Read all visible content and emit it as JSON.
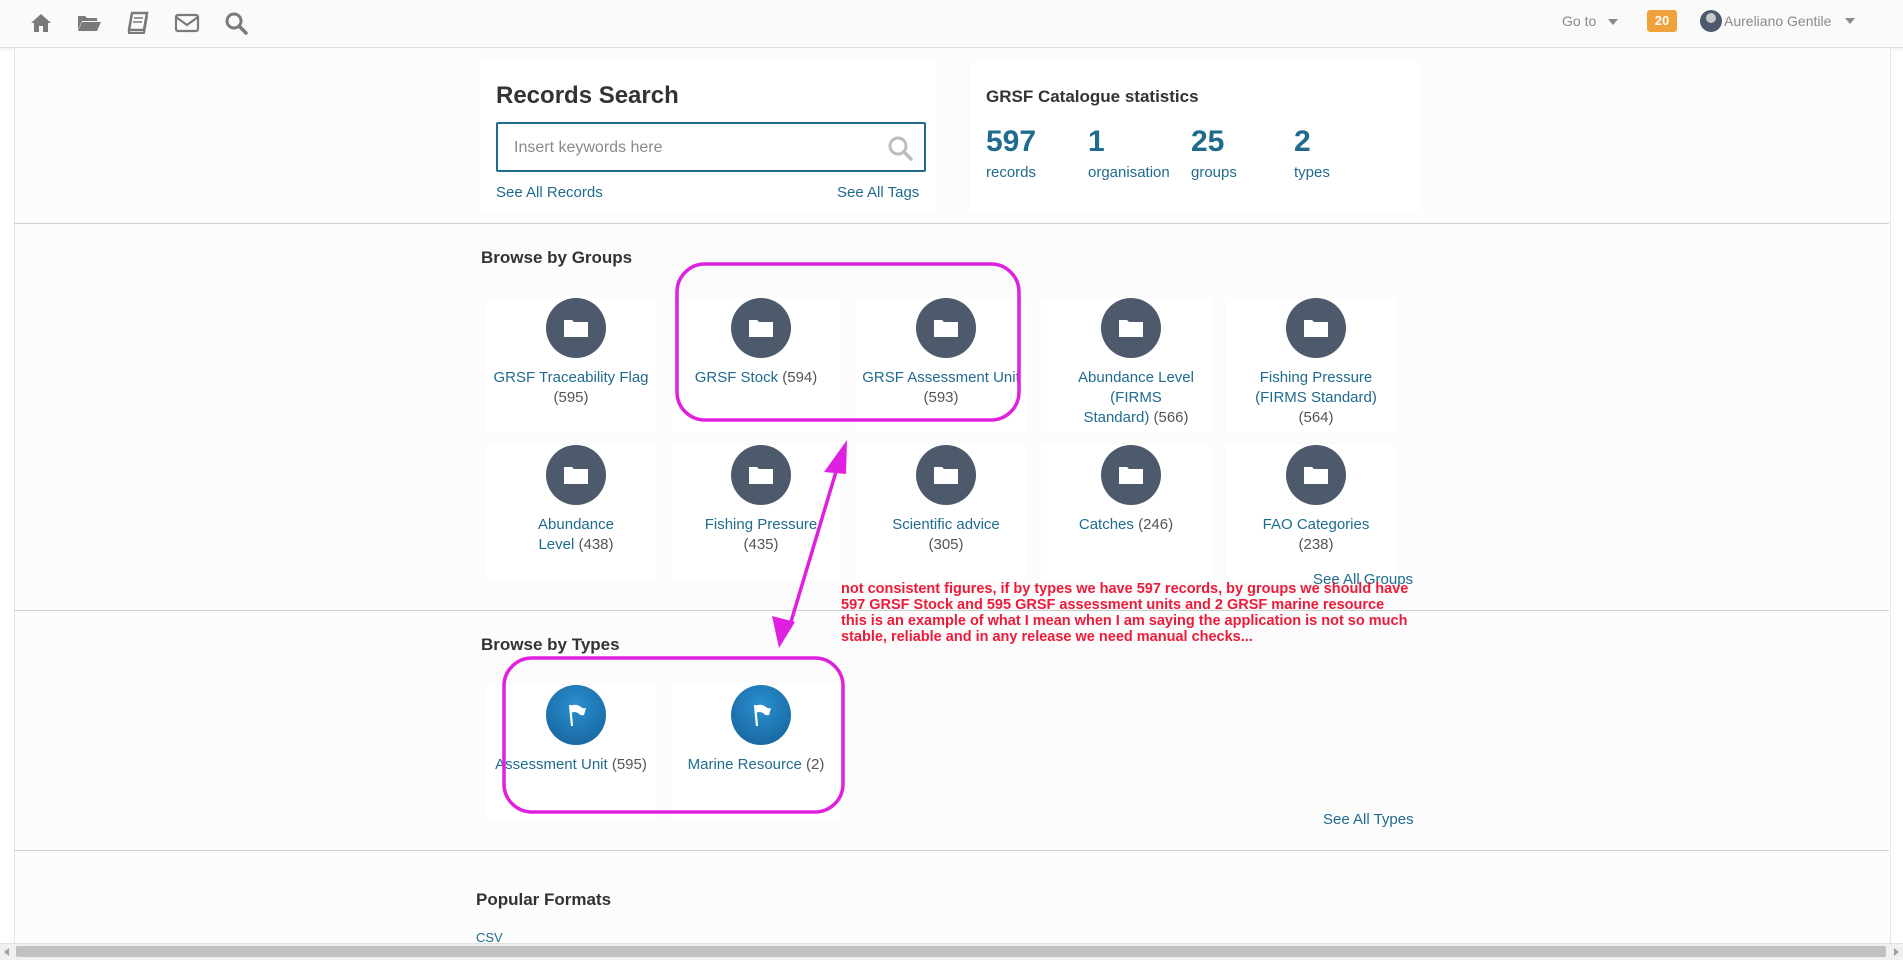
{
  "topbar": {
    "icons": [
      "home-icon",
      "folder-open-icon",
      "book-icon",
      "envelope-icon",
      "search-icon"
    ],
    "goto_label": "Go to",
    "notification_count": "20",
    "user_name": "Aureliano Gentile"
  },
  "search": {
    "title": "Records Search",
    "placeholder": "Insert keywords here",
    "see_all_records": "See All Records",
    "see_all_tags": "See All Tags"
  },
  "stats": {
    "title": "GRSF Catalogue statistics",
    "items": [
      {
        "num": "597",
        "label": "records"
      },
      {
        "num": "1",
        "label": "organisation"
      },
      {
        "num": "25",
        "label": "groups"
      },
      {
        "num": "2",
        "label": "types"
      }
    ]
  },
  "groups": {
    "title": "Browse by Groups",
    "see_all": "See All Groups",
    "items": [
      {
        "name": "GRSF Traceability Flag",
        "count": "(595)"
      },
      {
        "name": "GRSF Stock",
        "count": "(594)"
      },
      {
        "name": "GRSF Assessment Unit",
        "count": "(593)"
      },
      {
        "name": "Abundance Level (FIRMS Standard)",
        "count": "(566)"
      },
      {
        "name": "Fishing Pressure (FIRMS Standard)",
        "count": "(564)"
      },
      {
        "name": "Abundance Level",
        "count": "(438)"
      },
      {
        "name": "Fishing Pressure",
        "count": "(435)"
      },
      {
        "name": "Scientific advice",
        "count": "(305)"
      },
      {
        "name": "Catches",
        "count": "(246)"
      },
      {
        "name": "FAO Categories",
        "count": "(238)"
      }
    ]
  },
  "types": {
    "title": "Browse by Types",
    "see_all": "See All Types",
    "items": [
      {
        "name": "Assessment Unit",
        "count": "(595)"
      },
      {
        "name": "Marine Resource",
        "count": "(2)"
      }
    ]
  },
  "formats": {
    "title": "Popular Formats",
    "first": "CSV"
  },
  "annotation": {
    "lines": [
      "not consistent figures, if by types we have 597 records, by groups we should have",
      "597 GRSF Stock and 595 GRSF assessment units and 2 GRSF marine resource",
      "this is an example of what I mean when I am saying the application is not so much",
      "stable, reliable and in any release we need manual checks..."
    ],
    "color": "#ee1a3a",
    "highlight_color": "#e020e0"
  },
  "colors": {
    "link": "#1f6b8e",
    "group_circle": "#4d5a6b",
    "type_circle": "#1a7ab9",
    "badge": "#f0a23a"
  }
}
